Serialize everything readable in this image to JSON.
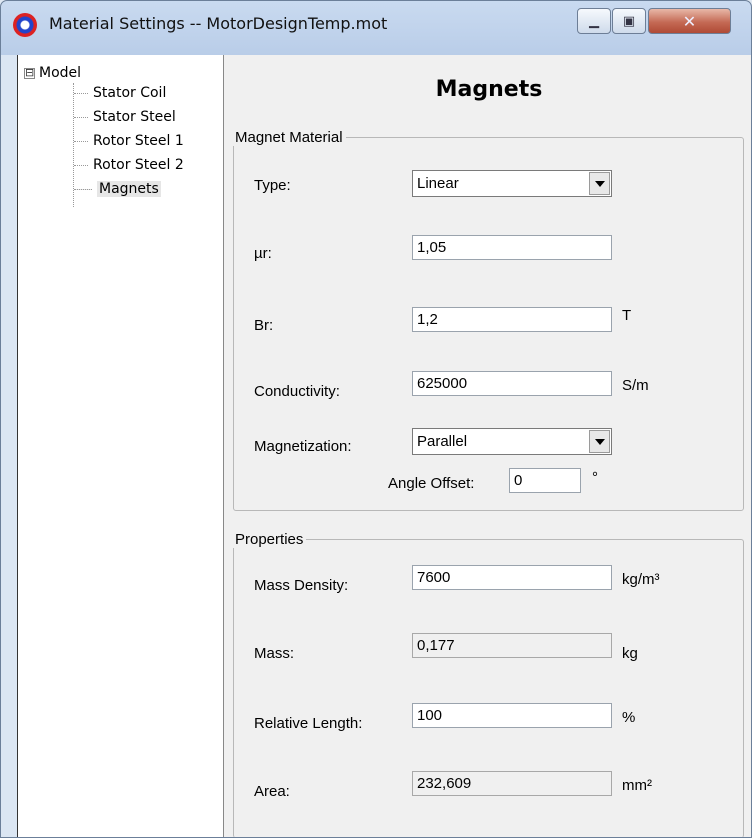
{
  "window": {
    "title": "Material Settings -- MotorDesignTemp.mot"
  },
  "tree": {
    "root_label": "Model",
    "expander": "⊟",
    "items": [
      "Stator Coil",
      "Stator Steel",
      "Rotor Steel 1",
      "Rotor Steel 2",
      "Magnets"
    ],
    "selected": "Magnets"
  },
  "panel": {
    "title": "Magnets",
    "magnet_material": {
      "legend": "Magnet Material",
      "type": {
        "label": "Type:",
        "value": "Linear"
      },
      "mur": {
        "label": "µr:",
        "value": "1,05"
      },
      "br": {
        "label": "Br:",
        "value": "1,2",
        "unit": "T"
      },
      "conductivity": {
        "label": "Conductivity:",
        "value": "625000",
        "unit": "S/m"
      },
      "magnetization": {
        "label": "Magnetization:",
        "value": "Parallel"
      },
      "angle_offset": {
        "label": "Angle Offset:",
        "value": "0",
        "unit": "°"
      }
    },
    "properties": {
      "legend": "Properties",
      "mass_density": {
        "label": "Mass Density:",
        "value": "7600",
        "unit": "kg/m³"
      },
      "mass": {
        "label": "Mass:",
        "value": "0,177",
        "unit": "kg"
      },
      "relative_length": {
        "label": "Relative Length:",
        "value": "100",
        "unit": "%"
      },
      "area": {
        "label": "Area:",
        "value": "232,609",
        "unit": "mm²"
      }
    }
  }
}
